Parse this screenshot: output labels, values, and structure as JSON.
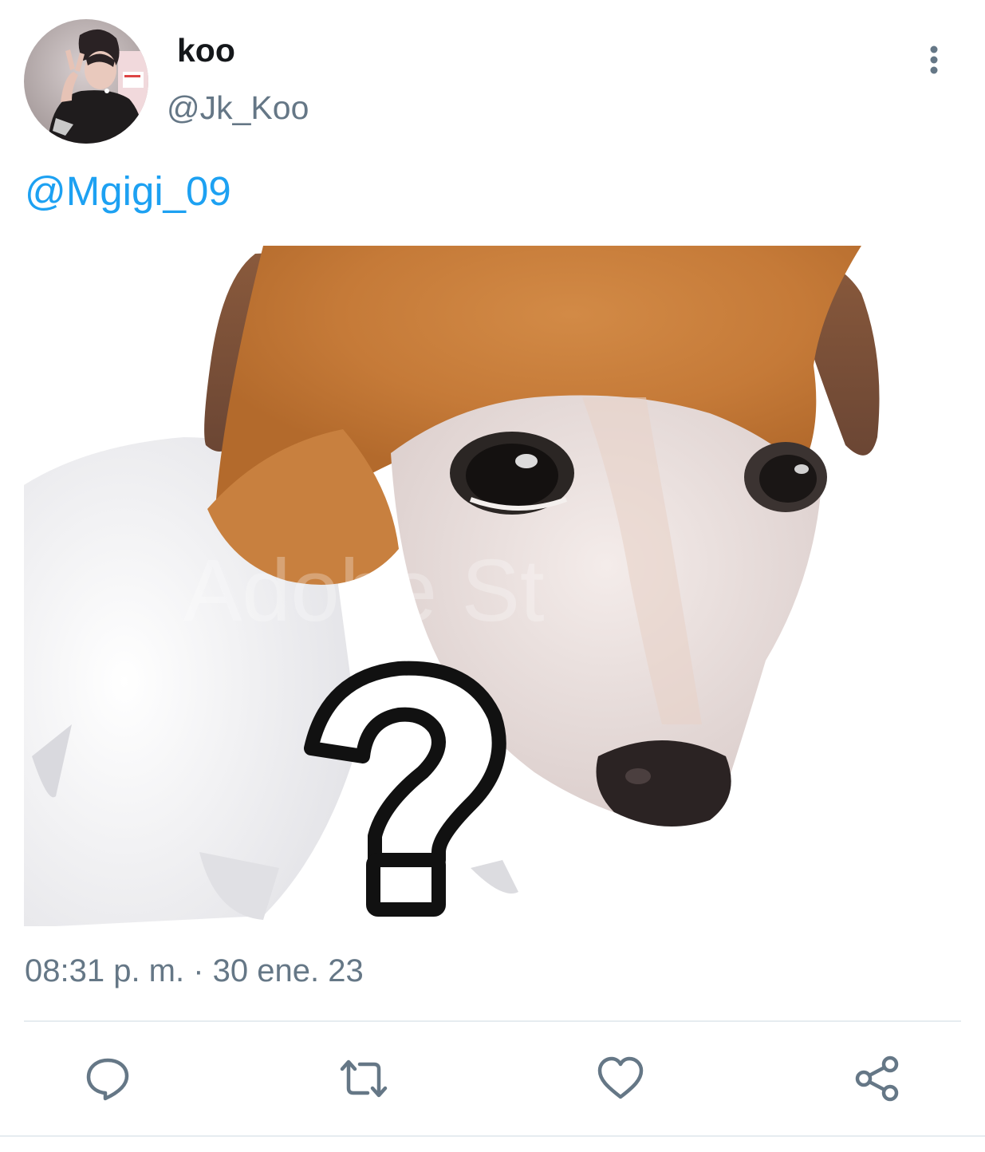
{
  "tweet": {
    "author": {
      "display_name": "koo",
      "handle": "@Jk_Koo"
    },
    "text_mention": "@Mgigi_09",
    "timestamp": "08:31 p. m. · 30 ene. 23"
  },
  "icons": {
    "more": "more-vertical-icon",
    "reply": "reply-icon",
    "retweet": "retweet-icon",
    "like": "heart-icon",
    "share": "share-icon"
  },
  "colors": {
    "link": "#1da1f2",
    "secondary_text": "#657786",
    "primary_text": "#14171a",
    "icon": "#657786",
    "divider": "#e6ecf0"
  }
}
